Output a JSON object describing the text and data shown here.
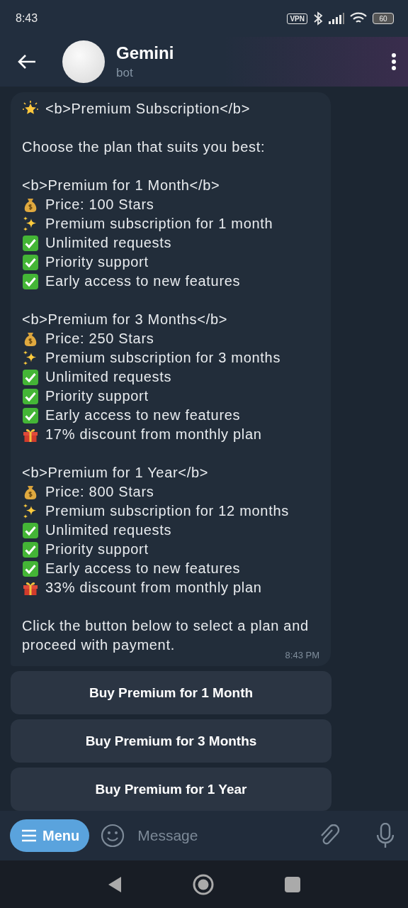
{
  "status_bar": {
    "time": "8:43",
    "vpn_label": "VPN",
    "battery": "60"
  },
  "header": {
    "title": "Gemini",
    "subtitle": "bot"
  },
  "message": {
    "time": "8:43 PM",
    "blocks": [
      [
        {
          "kind": "star",
          "text": "<b>Premium Subscription</b>"
        }
      ],
      [
        {
          "text": "Choose the plan that suits you best:"
        }
      ],
      [
        {
          "text": "<b>Premium for 1 Month</b>"
        },
        {
          "kind": "moneybag",
          "text": "Price: 100 Stars"
        },
        {
          "kind": "sparkles",
          "text": "Premium subscription for 1 month"
        },
        {
          "kind": "check",
          "text": "Unlimited requests"
        },
        {
          "kind": "check",
          "text": "Priority support"
        },
        {
          "kind": "check",
          "text": "Early access to new features"
        }
      ],
      [
        {
          "text": "<b>Premium for 3 Months</b>"
        },
        {
          "kind": "moneybag",
          "text": "Price: 250 Stars"
        },
        {
          "kind": "sparkles",
          "text": "Premium subscription for 3 months"
        },
        {
          "kind": "check",
          "text": "Unlimited requests"
        },
        {
          "kind": "check",
          "text": "Priority support"
        },
        {
          "kind": "check",
          "text": "Early access to new features"
        },
        {
          "kind": "gift",
          "text": "17% discount from monthly plan"
        }
      ],
      [
        {
          "text": "<b>Premium for 1 Year</b>"
        },
        {
          "kind": "moneybag",
          "text": "Price: 800 Stars"
        },
        {
          "kind": "sparkles",
          "text": "Premium subscription for 12 months"
        },
        {
          "kind": "check",
          "text": "Unlimited requests"
        },
        {
          "kind": "check",
          "text": "Priority support"
        },
        {
          "kind": "check",
          "text": "Early access to new features"
        },
        {
          "kind": "gift",
          "text": "33% discount from monthly plan"
        }
      ],
      [
        {
          "text": "Click the button below to select a plan and proceed with payment."
        }
      ]
    ]
  },
  "inline_buttons": [
    "Buy Premium for 1 Month",
    "Buy Premium for 3 Months",
    "Buy Premium for 1 Year"
  ],
  "input_bar": {
    "menu_label": "Menu",
    "placeholder": "Message"
  }
}
